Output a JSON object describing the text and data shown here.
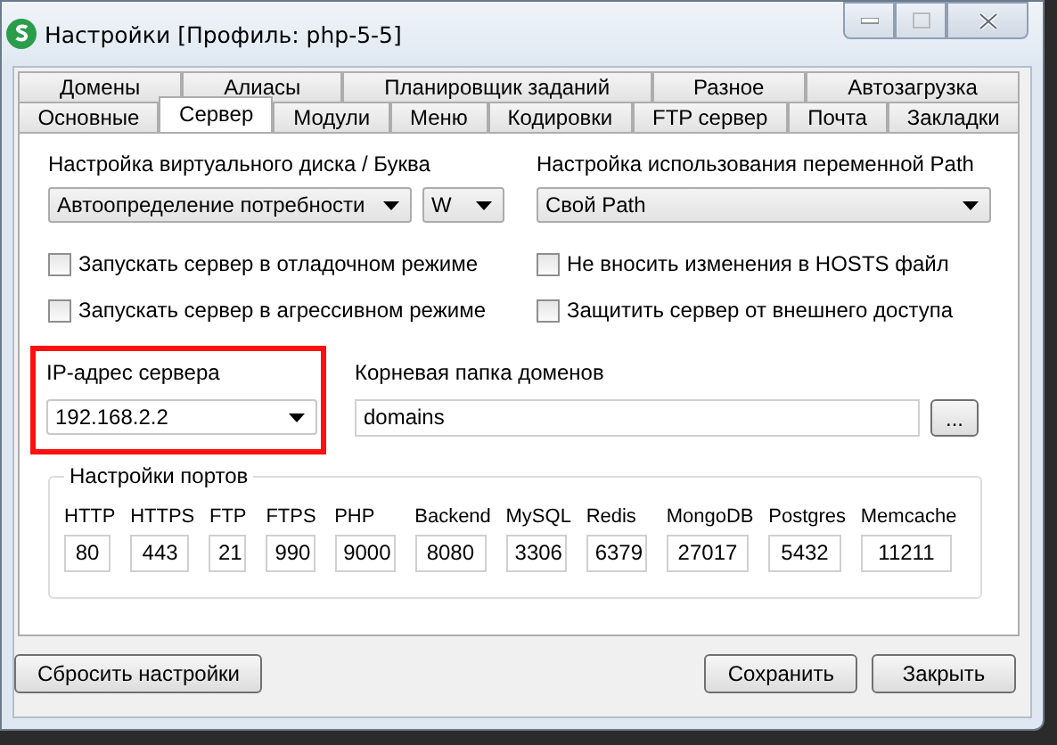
{
  "window": {
    "title": "Настройки [Профиль: php-5-5]"
  },
  "tabs": [
    [
      {
        "label": "Домены",
        "selected": false
      },
      {
        "label": "Алиасы",
        "selected": false
      },
      {
        "label": "Планировщик заданий",
        "selected": false
      },
      {
        "label": "Разное",
        "selected": false
      },
      {
        "label": "Автозагрузка",
        "selected": false
      }
    ],
    [
      {
        "label": "Основные",
        "selected": false
      },
      {
        "label": "Сервер",
        "selected": true
      },
      {
        "label": "Модули",
        "selected": false
      },
      {
        "label": "Меню",
        "selected": false
      },
      {
        "label": "Кодировки",
        "selected": false
      },
      {
        "label": "FTP сервер",
        "selected": false
      },
      {
        "label": "Почта",
        "selected": false
      },
      {
        "label": "Закладки",
        "selected": false
      }
    ]
  ],
  "disk": {
    "label": "Настройка виртуального диска / Буква",
    "mode": "Автоопределение потребности",
    "letter": "W"
  },
  "path": {
    "label": "Настройка использования переменной Path",
    "value": "Свой Path"
  },
  "checkboxes": [
    {
      "label": "Запускать сервер в отладочном режиме",
      "checked": false
    },
    {
      "label": "Не вносить изменения в HOSTS файл",
      "checked": false
    },
    {
      "label": "Запускать сервер в агрессивном режиме",
      "checked": false
    },
    {
      "label": "Защитить сервер от внешнего доступа",
      "checked": false
    }
  ],
  "server_ip": {
    "label": "IP-адрес сервера",
    "value": "192.168.2.2",
    "highlighted": true
  },
  "root_folder": {
    "label": "Корневая папка доменов",
    "value": "domains",
    "browse": "..."
  },
  "ports": {
    "title": "Настройки портов",
    "items": [
      {
        "name": "HTTP",
        "value": "80"
      },
      {
        "name": "HTTPS",
        "value": "443"
      },
      {
        "name": "FTP",
        "value": "21"
      },
      {
        "name": "FTPS",
        "value": "990"
      },
      {
        "name": "PHP",
        "value": "9000"
      },
      {
        "name": "Backend",
        "value": "8080"
      },
      {
        "name": "MySQL",
        "value": "3306"
      },
      {
        "name": "Redis",
        "value": "6379"
      },
      {
        "name": "MongoDB",
        "value": "27017"
      },
      {
        "name": "Postgres",
        "value": "5432"
      },
      {
        "name": "Memcache",
        "value": "11211"
      }
    ]
  },
  "buttons": {
    "reset": "Сбросить настройки",
    "save": "Сохранить",
    "close": "Закрыть"
  }
}
